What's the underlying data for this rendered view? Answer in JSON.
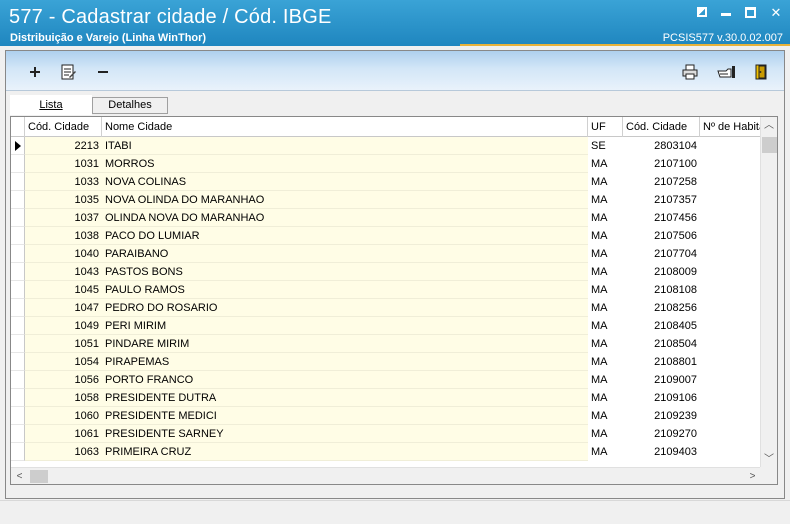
{
  "window": {
    "title": "577 - Cadastrar cidade / Cód. IBGE",
    "subtitle": "Distribuição e Varejo (Linha WinThor)",
    "version": "PCSIS577  v.30.0.02.007"
  },
  "toolbar": {
    "left_icons": [
      "add-icon",
      "edit-document-icon",
      "remove-icon"
    ],
    "right_icons": [
      "print-icon",
      "search-hand-icon",
      "exit-door-icon"
    ]
  },
  "tabs": [
    {
      "label": "Lista",
      "active": true
    },
    {
      "label": "Detalhes",
      "active": false
    }
  ],
  "grid": {
    "columns": [
      "Cód. Cidade",
      "Nome Cidade",
      "UF",
      "Cód. Cidade",
      "Nº de Habita"
    ],
    "rows": [
      {
        "cod": "2213",
        "nome": "ITABI",
        "uf": "SE",
        "ibge": "2803104",
        "hab": ""
      },
      {
        "cod": "1031",
        "nome": "MORROS",
        "uf": "MA",
        "ibge": "2107100",
        "hab": ""
      },
      {
        "cod": "1033",
        "nome": "NOVA COLINAS",
        "uf": "MA",
        "ibge": "2107258",
        "hab": ""
      },
      {
        "cod": "1035",
        "nome": "NOVA OLINDA DO MARANHAO",
        "uf": "MA",
        "ibge": "2107357",
        "hab": ""
      },
      {
        "cod": "1037",
        "nome": "OLINDA NOVA DO MARANHAO",
        "uf": "MA",
        "ibge": "2107456",
        "hab": ""
      },
      {
        "cod": "1038",
        "nome": "PACO DO LUMIAR",
        "uf": "MA",
        "ibge": "2107506",
        "hab": ""
      },
      {
        "cod": "1040",
        "nome": "PARAIBANO",
        "uf": "MA",
        "ibge": "2107704",
        "hab": ""
      },
      {
        "cod": "1043",
        "nome": "PASTOS BONS",
        "uf": "MA",
        "ibge": "2108009",
        "hab": ""
      },
      {
        "cod": "1045",
        "nome": "PAULO RAMOS",
        "uf": "MA",
        "ibge": "2108108",
        "hab": ""
      },
      {
        "cod": "1047",
        "nome": "PEDRO DO ROSARIO",
        "uf": "MA",
        "ibge": "2108256",
        "hab": ""
      },
      {
        "cod": "1049",
        "nome": "PERI MIRIM",
        "uf": "MA",
        "ibge": "2108405",
        "hab": ""
      },
      {
        "cod": "1051",
        "nome": "PINDARE MIRIM",
        "uf": "MA",
        "ibge": "2108504",
        "hab": ""
      },
      {
        "cod": "1054",
        "nome": "PIRAPEMAS",
        "uf": "MA",
        "ibge": "2108801",
        "hab": ""
      },
      {
        "cod": "1056",
        "nome": "PORTO FRANCO",
        "uf": "MA",
        "ibge": "2109007",
        "hab": ""
      },
      {
        "cod": "1058",
        "nome": "PRESIDENTE DUTRA",
        "uf": "MA",
        "ibge": "2109106",
        "hab": ""
      },
      {
        "cod": "1060",
        "nome": "PRESIDENTE MEDICI",
        "uf": "MA",
        "ibge": "2109239",
        "hab": ""
      },
      {
        "cod": "1061",
        "nome": "PRESIDENTE SARNEY",
        "uf": "MA",
        "ibge": "2109270",
        "hab": ""
      },
      {
        "cod": "1063",
        "nome": "PRIMEIRA CRUZ",
        "uf": "MA",
        "ibge": "2109403",
        "hab": ""
      }
    ]
  },
  "colors": {
    "titlebar": "#2b95cb",
    "accent_line": "#e8b23a",
    "grid_highlight": "#fffde6"
  }
}
